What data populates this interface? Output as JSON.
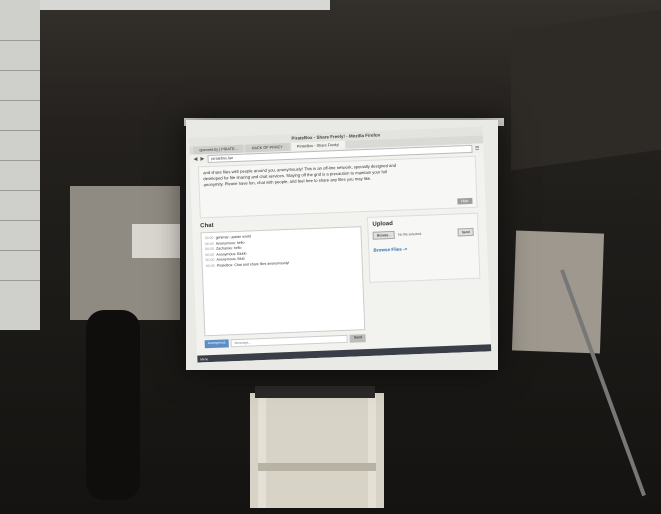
{
  "browser": {
    "window_title": "PirateBox - Share Freely! - Mozilla Firefox",
    "tabs": [
      {
        "label": "opennet.by | PIRATE..."
      },
      {
        "label": "HACK OF PRACY"
      },
      {
        "label": "PirateBox - Share Freely!"
      }
    ],
    "url": "piratebox.lan"
  },
  "intro": {
    "text_line1": "and share files with people around you, anonymously! This is an off-line network, specially designed and",
    "text_line2": "developed for file sharing and chat services. Staying off the grid is a precaution to maintain your full",
    "text_line3": "anonymity. Please have fun, chat with people, and feel free to share any files you may like.",
    "hide_label": "Hide"
  },
  "chat": {
    "title": "Chat",
    "messages": [
      {
        "time": "00:00",
        "text": "gehimar: upside world"
      },
      {
        "time": "00:00",
        "text": "Anonymous: hello"
      },
      {
        "time": "00:00",
        "text": "Zacharias: hello"
      },
      {
        "time": "00:00",
        "text": "Anonymous: Blubb"
      },
      {
        "time": "00:00",
        "text": "Anonymous: Blub"
      },
      {
        "time": "00:00",
        "text": "PirateBox: Chat and share files anonymously!"
      }
    ],
    "nick_label": "Anonymous",
    "message_placeholder": "Message...",
    "send_label": "Send"
  },
  "upload": {
    "title": "Upload",
    "browse_label": "Browse...",
    "no_file_label": "No file selected.",
    "send_label": "Send",
    "browse_files_label": "Browse Files ->"
  },
  "taskbar": {
    "start_label": "Menu"
  }
}
